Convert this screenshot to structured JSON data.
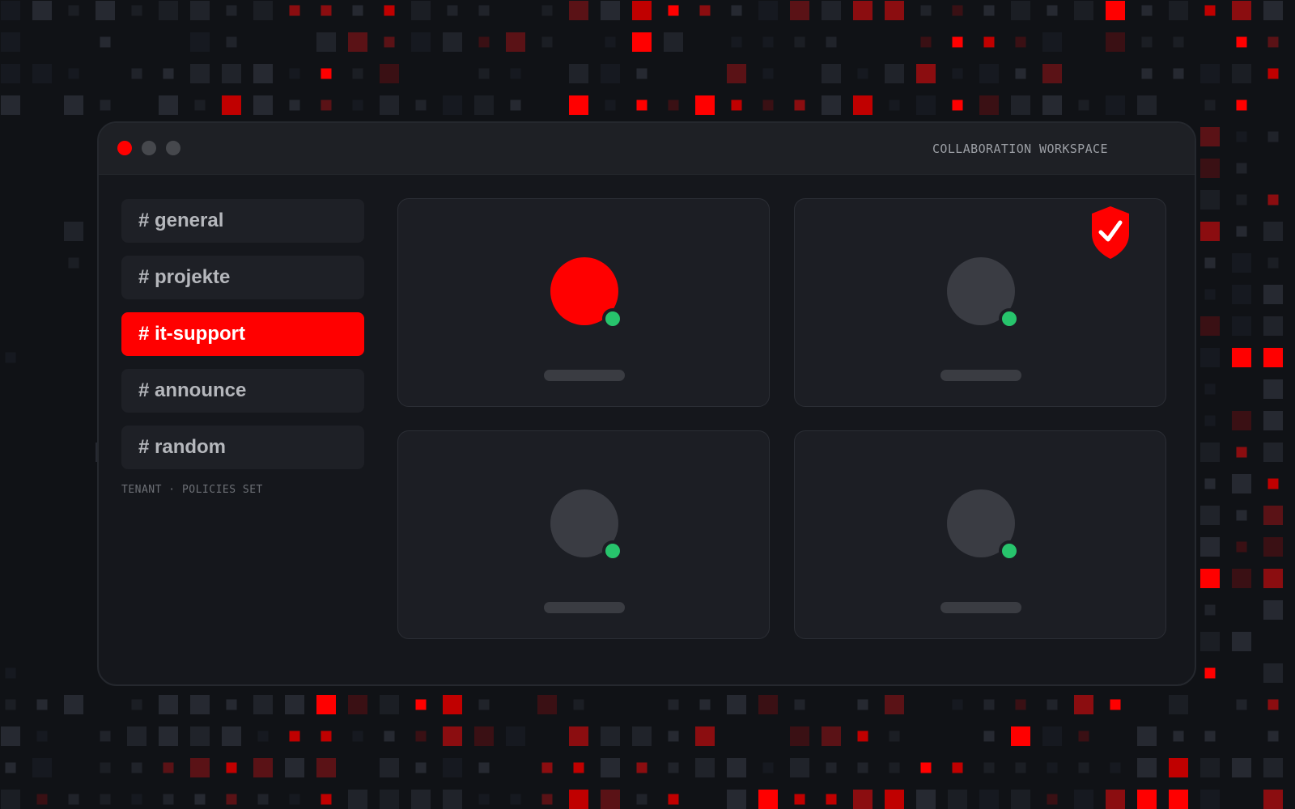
{
  "app": {
    "window_title": "COLLABORATION WORKSPACE",
    "window_controls": [
      "close",
      "minimize",
      "maximize"
    ]
  },
  "sidebar": {
    "channels": [
      {
        "label": "# general",
        "active": false
      },
      {
        "label": "# projekte",
        "active": false
      },
      {
        "label": "# it-support",
        "active": true
      },
      {
        "label": "# announce",
        "active": false
      },
      {
        "label": "# random",
        "active": false
      }
    ],
    "footer": "TENANT · POLICIES SET"
  },
  "main": {
    "participants": [
      {
        "avatar": "accent",
        "status": "online",
        "badge": ""
      },
      {
        "avatar": "neutral",
        "status": "online",
        "badge": "shield-check-icon"
      },
      {
        "avatar": "neutral",
        "status": "online",
        "badge": ""
      },
      {
        "avatar": "neutral",
        "status": "online",
        "badge": ""
      }
    ]
  },
  "colors": {
    "accent": "#ff0000",
    "online": "#27c46c",
    "background": "#101216",
    "window": "#15171c"
  }
}
